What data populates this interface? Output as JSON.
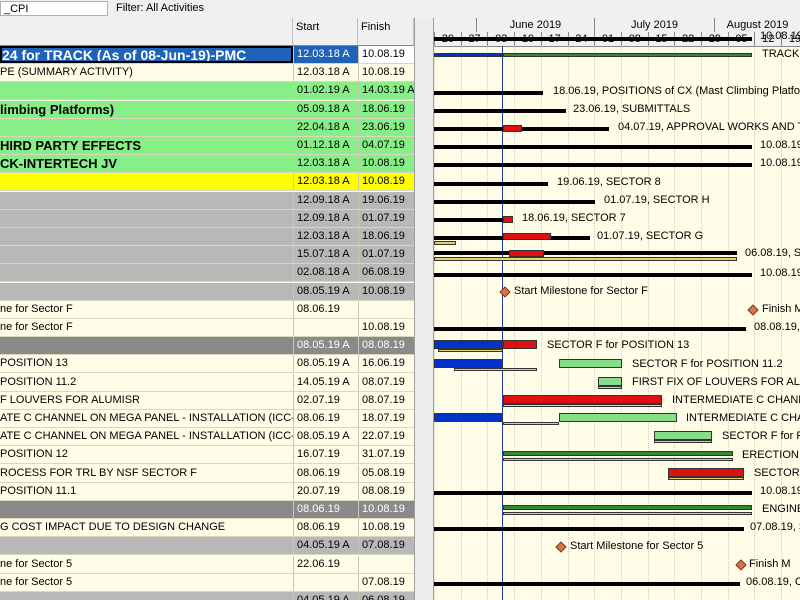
{
  "toolbar": {
    "layout_field": "_CPI",
    "filter": "Filter: All Activities"
  },
  "columns": {
    "start": "Start",
    "finish": "Finish"
  },
  "timescale": {
    "months": [
      "June 2019",
      "July 2019",
      "August 2019"
    ],
    "days": [
      "20",
      "27",
      "03",
      "10",
      "17",
      "24",
      "01",
      "08",
      "15",
      "22",
      "29",
      "05",
      "12",
      "19"
    ]
  },
  "rows": [
    {
      "name": "24 for TRACK (As of 08-Jun-19)-PMC",
      "start": "12.03.18 A",
      "finish": "10.08.19",
      "style": "selected"
    },
    {
      "name": "PE (SUMMARY ACTIVITY)",
      "start": "12.03.18 A",
      "finish": "10.08.19",
      "style": "plain"
    },
    {
      "name": "",
      "start": "01.02.19 A",
      "finish": "14.03.19 A",
      "style": "green"
    },
    {
      "name": "limbing Platforms)",
      "start": "05.09.18 A",
      "finish": "18.06.19",
      "style": "green"
    },
    {
      "name": "",
      "start": "22.04.18 A",
      "finish": "23.06.19",
      "style": "green"
    },
    {
      "name": "HIRD PARTY EFFECTS",
      "start": "01.12.18 A",
      "finish": "04.07.19",
      "style": "green"
    },
    {
      "name": "CK-INTERTECH JV",
      "start": "12.03.18 A",
      "finish": "10.08.19",
      "style": "green"
    },
    {
      "name": "",
      "start": "12.03.18 A",
      "finish": "10.08.19",
      "style": "yellow"
    },
    {
      "name": "",
      "start": "12.09.18 A",
      "finish": "19.06.19",
      "style": "gray"
    },
    {
      "name": "",
      "start": "12.09.18 A",
      "finish": "01.07.19",
      "style": "gray"
    },
    {
      "name": "",
      "start": "12.03.18 A",
      "finish": "18.06.19",
      "style": "gray"
    },
    {
      "name": "",
      "start": "15.07.18 A",
      "finish": "01.07.19",
      "style": "gray"
    },
    {
      "name": "",
      "start": "02.08.18 A",
      "finish": "06.08.19",
      "style": "gray"
    },
    {
      "name": "",
      "start": "08.05.19 A",
      "finish": "10.08.19",
      "style": "gray"
    },
    {
      "name": "ne for Sector F",
      "start": "08.06.19",
      "finish": "",
      "style": "plain"
    },
    {
      "name": "ne for Sector F",
      "start": "",
      "finish": "10.08.19",
      "style": "plain"
    },
    {
      "name": "",
      "start": "08.05.19 A",
      "finish": "08.08.19",
      "style": "darkgray"
    },
    {
      "name": "POSITION 13",
      "start": "08.05.19 A",
      "finish": "16.06.19",
      "style": "plain"
    },
    {
      "name": "POSITION 11.2",
      "start": "14.05.19 A",
      "finish": "08.07.19",
      "style": "plain"
    },
    {
      "name": "F LOUVERS FOR ALUMISR",
      "start": "02.07.19",
      "finish": "08.07.19",
      "style": "plain"
    },
    {
      "name": "ATE C CHANNEL ON MEGA PANEL - INSTALLATION (ICC-1)",
      "start": "08.06.19",
      "finish": "18.07.19",
      "style": "plain"
    },
    {
      "name": "ATE C CHANNEL ON MEGA PANEL - INSTALLATION (ICC-2)",
      "start": "08.05.19 A",
      "finish": "22.07.19",
      "style": "plain"
    },
    {
      "name": "POSITION 12",
      "start": "16.07.19",
      "finish": "31.07.19",
      "style": "plain"
    },
    {
      "name": "ROCESS FOR TRL BY NSF SECTOR F",
      "start": "08.06.19",
      "finish": "05.08.19",
      "style": "plain"
    },
    {
      "name": "POSITION 11.1",
      "start": "20.07.19",
      "finish": "08.08.19",
      "style": "plain"
    },
    {
      "name": "",
      "start": "08.06.19",
      "finish": "10.08.19",
      "style": "darkgray"
    },
    {
      "name": "G COST IMPACT DUE TO DESIGN CHANGE",
      "start": "08.06.19",
      "finish": "10.08.19",
      "style": "plain"
    },
    {
      "name": "",
      "start": "04.05.19 A",
      "finish": "07.08.19",
      "style": "gray"
    },
    {
      "name": "ne for Sector 5",
      "start": "22.06.19",
      "finish": "",
      "style": "plain"
    },
    {
      "name": "ne for Sector 5",
      "start": "",
      "finish": "07.08.19",
      "style": "plain"
    },
    {
      "name": "",
      "start": "04.05.19 A",
      "finish": "06.08.19",
      "style": "gray"
    }
  ],
  "gantt_labels": [
    "10.08.19,",
    "TRACK",
    "18.06.19, POSITIONS of CX (Mast Climbing Platforms",
    "23.06.19, SUBMITTALS",
    "04.07.19, APPROVAL WORKS AND TH",
    "10.08.19,",
    "10.08.19,",
    "19.06.19, SECTOR 8",
    "01.07.19, SECTOR H",
    "18.06.19, SECTOR 7",
    "01.07.19, SECTOR G",
    "06.08.19, S",
    "10.08.19,",
    "Start Milestone for Sector F",
    "Finish M",
    "08.08.19,",
    "SECTOR F for POSITION 13",
    "SECTOR F for POSITION 11.2",
    "FIRST FIX OF LOUVERS FOR ALUM",
    "INTERMEDIATE C CHANN",
    "INTERMEDIATE C CHA",
    "SECTOR F for P",
    "ERECTION",
    "SECTOR",
    "10.08.19,",
    "ENGINE",
    "07.08.19, S",
    "Start Milestone for Sector 5",
    "Finish M",
    "06.08.19, C"
  ],
  "colors": {
    "selected_bg": "#1f62b8",
    "green_bg": "#88ee88",
    "yellow_bg": "#ffff00",
    "gray_bg": "#b8b8b8",
    "darkgray_bg": "#8a8a8a",
    "plain_bg": "#fffde8",
    "summary_bar": "#000000",
    "critical_bar": "#dd1111",
    "normal_bar": "#88dd88",
    "actual_bar": "#0033cc",
    "baseline_bar": "#e6d26a",
    "green_summary": "#338833"
  }
}
